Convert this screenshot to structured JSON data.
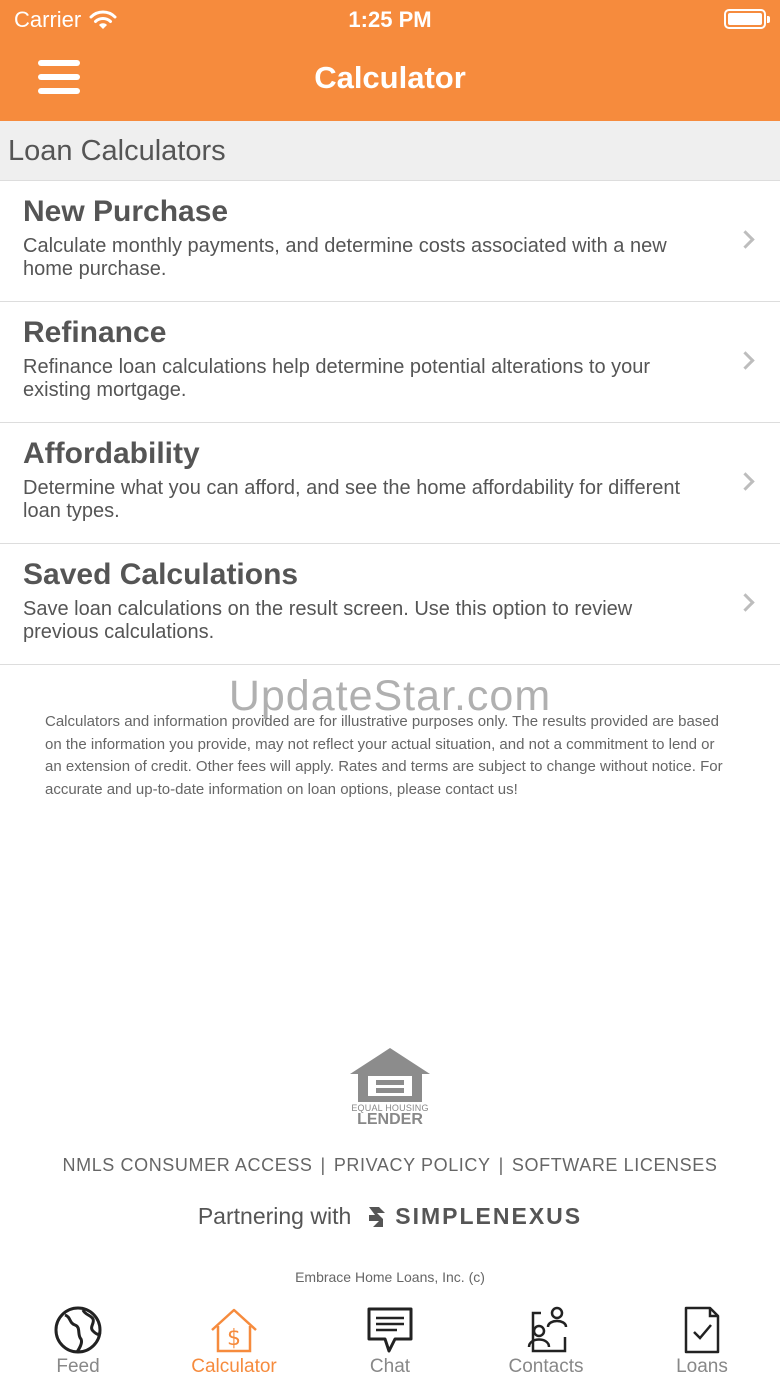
{
  "status_bar": {
    "carrier": "Carrier",
    "time": "1:25 PM"
  },
  "header": {
    "title": "Calculator",
    "menu_icon": "hamburger-icon"
  },
  "section": {
    "title": "Loan Calculators"
  },
  "calculators": [
    {
      "title": "New Purchase",
      "description": "Calculate monthly payments, and determine costs associated with a new home purchase."
    },
    {
      "title": "Refinance",
      "description": "Refinance loan calculations help determine potential alterations to your existing mortgage."
    },
    {
      "title": "Affordability",
      "description": "Determine what you can afford, and see the home affordability for different loan types."
    },
    {
      "title": "Saved Calculations",
      "description": "Save loan calculations on the result screen. Use this option to review previous calculations."
    }
  ],
  "watermark": "UpdateStar.com",
  "disclaimer": "Calculators and information provided are for illustrative purposes only. The results provided are based on the information you provide, may not reflect your actual situation, and not a commitment to lend or an extension of credit. Other fees will apply. Rates and terms are subject to change without notice. For accurate and up-to-date information on loan options, please contact us!",
  "equal_housing": {
    "line1": "EQUAL HOUSING",
    "line2": "LENDER"
  },
  "footer_links": {
    "nmls": "NMLS CONSUMER ACCESS",
    "privacy": "PRIVACY POLICY",
    "software": "SOFTWARE LICENSES",
    "separator": "|"
  },
  "partner": {
    "text": "Partnering with",
    "brand": "SIMPLENEXUS"
  },
  "copyright": "Embrace Home Loans, Inc. (c)",
  "tabs": [
    {
      "label": "Feed",
      "icon": "globe-icon"
    },
    {
      "label": "Calculator",
      "icon": "house-dollar-icon",
      "active": true
    },
    {
      "label": "Chat",
      "icon": "chat-icon"
    },
    {
      "label": "Contacts",
      "icon": "contacts-icon"
    },
    {
      "label": "Loans",
      "icon": "document-check-icon"
    }
  ],
  "colors": {
    "accent": "#f68b3d",
    "text": "#555555",
    "section_bg": "#efefef",
    "divider": "#dddddd"
  }
}
